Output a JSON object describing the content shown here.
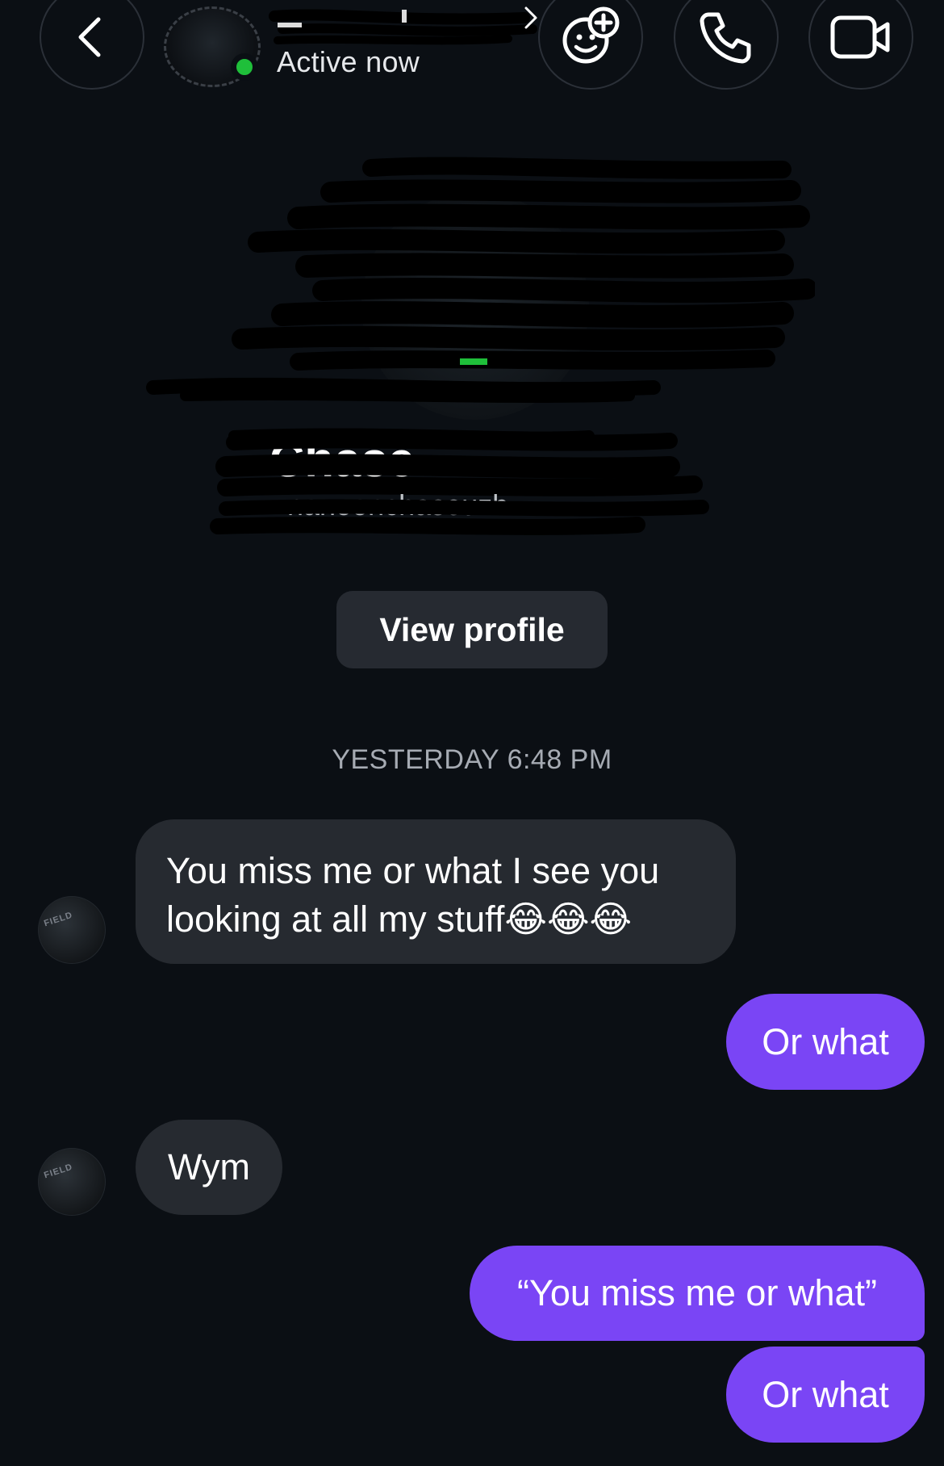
{
  "header": {
    "active_status": "Active now",
    "presence_color": "#1fbf3a",
    "icons": {
      "back": "chevron-left-icon",
      "effects": "sticker-add-icon",
      "call": "phone-icon",
      "video": "video-camera-icon"
    }
  },
  "profile": {
    "view_profile_label": "View profile"
  },
  "conversation": {
    "timestamp": "YESTERDAY 6:48 PM",
    "messages": [
      {
        "direction": "incoming",
        "text": "You miss me or what I see you looking at all my stuff😂😂😂"
      },
      {
        "direction": "outgoing",
        "text": "Or what"
      },
      {
        "direction": "incoming",
        "text": "Wym"
      },
      {
        "direction": "outgoing",
        "text": "“You miss me or what”"
      },
      {
        "direction": "outgoing",
        "text": "Or what"
      }
    ]
  },
  "colors": {
    "background": "#0b0f14",
    "incoming_bubble": "#262a30",
    "outgoing_bubble": "#7a45f5",
    "button_bg": "#262a31"
  }
}
